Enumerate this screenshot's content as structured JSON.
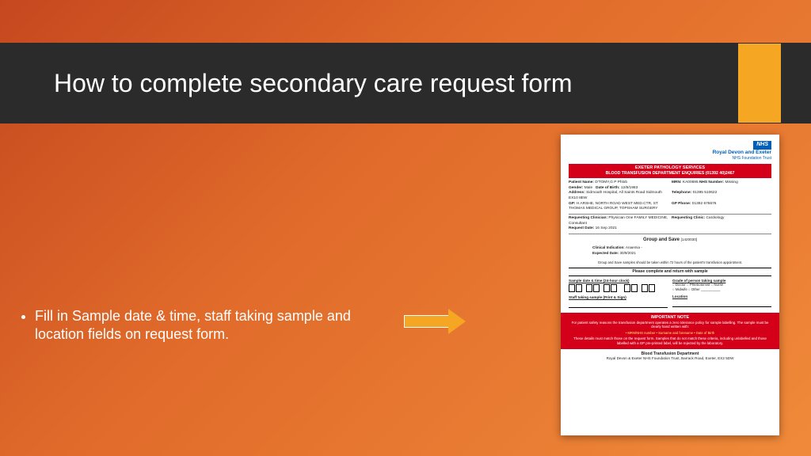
{
  "title": "How to complete secondary care request form",
  "bullet": "Fill in Sample date & time, staff taking sample and location fields on request form.",
  "form": {
    "nhs_logo": "NHS",
    "trust": "Royal Devon and Exeter",
    "trust_sub": "NHS Foundation Trust",
    "red_line1": "EXETER PATHOLOGY SERVICES",
    "red_line2": "BLOOD TRANSFUSION DEPARTMENT ENQUIRIES (01392 40)2467",
    "demo": {
      "patient_name_lbl": "Patient Name:",
      "patient_name": "D'TOMY,G P Phlob",
      "mrn_lbl": "MRN:",
      "mrn": "KA00695",
      "nhs_num_lbl": "NHS Number:",
      "nhs_num": "Missing",
      "gender_lbl": "Gender:",
      "gender": "Male",
      "dob_lbl": "Date of Birth:",
      "dob": "12/8/1983",
      "address_lbl": "Address:",
      "address": "Sidmouth Hospital, All Saints Road Sidmouth EX10 8EW",
      "tel_lbl": "Telephone:",
      "tel": "01395 510622",
      "gp_lbl": "GP:",
      "gp": "H ARSHE, NORTH ROAD WEST MED.CTR, ST THOMAS MEDICAL GROUP, TOPSHAM SURGERY",
      "gp_phone_lbl": "GP Phone:",
      "gp_phone": "01392 676676",
      "req_clin_lbl": "Requesting Clinician:",
      "req_clin": "Physician One FAMILY MEDICINE, Consultant",
      "req_clinic_lbl": "Requesting Clinic:",
      "req_clinic": "Cardiology",
      "req_date_lbl": "Request Date:",
      "req_date": "16 Sep 2021"
    },
    "gs_title": "Group and Save",
    "gs_code": "[1420030]",
    "ci_lbl": "Clinical Indication:",
    "ci": "Anaemia -",
    "ed_lbl": "Expected Date:",
    "ed": "30/9/2021",
    "gs_note": "Group and Save samples should be taken within 72 hours of the patient's transfusion appointment.",
    "pcr": "Please complete and return with sample",
    "sample_dt_lbl": "Sample date & time (24-hour clock)",
    "grade_lbl": "Grade of person taking sample",
    "grade_opts": "○ Doctor  ○ Phlebotomist  ○ Nurse\n○ Midwife  ○ Other __________",
    "staff_lbl": "Staff taking sample (Print & Sign)",
    "loc_lbl": "Location",
    "imp_head": "IMPORTANT NOTE",
    "imp_body1": "For patient safety reasons the transfusion department operates a zero tolerance policy for sample labelling. The sample must be clearly hand written with:",
    "imp_bullets": "• MRN/NHS number    • Surname and forename    • Date of Birth",
    "imp_body2": "These details must match those on the request form. Samples that do not match these criteria, including unlabelled and those labelled with a GP pre-printed label, will be rejected by the laboratory.",
    "footer_dept": "Blood Transfusion Department",
    "footer_addr": "Royal Devon & Exeter NHS Foundation Trust, Barrack Road, Exeter, EX2 5DW"
  }
}
